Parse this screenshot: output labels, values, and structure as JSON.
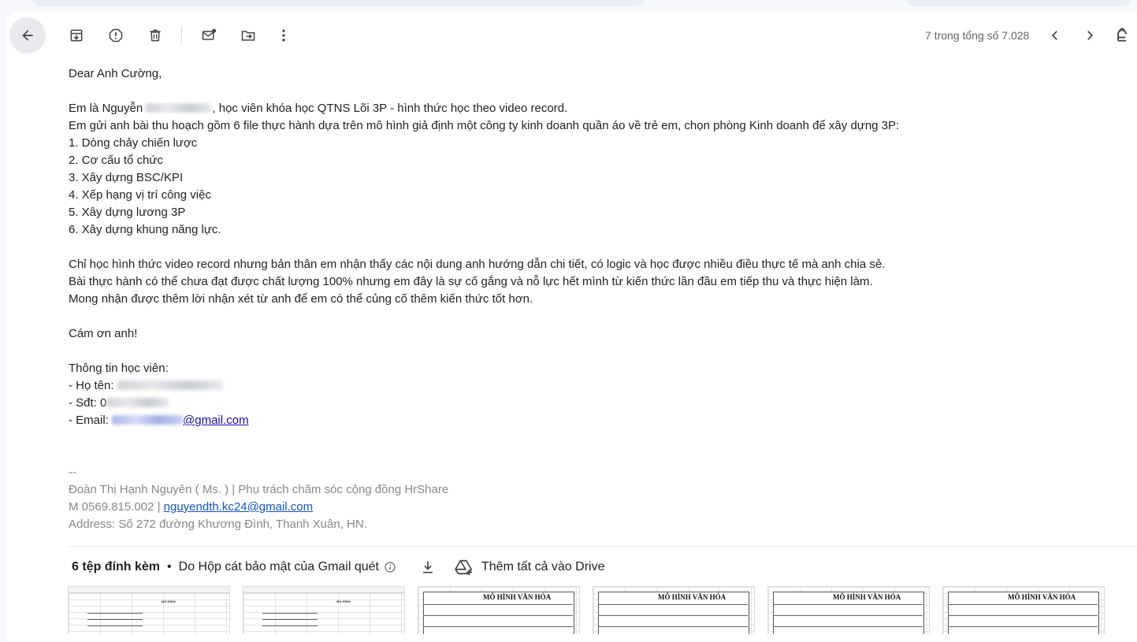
{
  "toolbar": {
    "pager_text": "7 trong tổng số 7.028",
    "icons": [
      "arrow-back-icon",
      "archive-icon",
      "report-spam-icon",
      "delete-icon",
      "mark-unread-icon",
      "move-to-icon",
      "more-vert-icon",
      "chevron-left-icon",
      "chevron-right-icon",
      "input-tools-icon"
    ]
  },
  "email": {
    "greeting": "Dear Anh Cường,",
    "intro_prefix": "Em là Nguyễn ",
    "intro_suffix": ", học viên khóa học QTNS Lõi 3P - hình thức học theo video record.",
    "line2": "Em gửi anh bài thu hoạch gồm 6 file thực hành dựa trên mô hình giả định một công ty kinh doanh quần áo về trẻ em, chọn phòng Kinh doanh để xây dựng 3P:",
    "list": [
      "1. Dòng chảy chiến lược",
      "2. Cơ cấu tổ chức",
      "3. Xây dựng BSC/KPI",
      "4. Xếp hạng vị trí công việc",
      "5. Xây dựng lương 3P",
      "6. Xây dựng khung năng lực."
    ],
    "para1": "Chỉ học hình thức video record nhưng bản thân em nhận thấy các nội dung anh hướng dẫn chi tiết, có logic và học được nhiều điều thực tế mà anh chia sẻ.",
    "para2": "Bài thực hành có thể chưa đạt được chất lượng 100% nhưng em đây là sự cố gắng và nỗ lực hết mình từ kiến thức lần đầu em tiếp thu và thực hiện làm.",
    "para3": "Mong nhận được thêm lời nhận xét từ anh để em có thể củng cố thêm kiến thức tốt hơn.",
    "thanks": "Cám ơn anh!",
    "info_title": "Thông tin học viên:",
    "info_name_label": "- Họ tên: ",
    "info_phone_label": "- Sđt: 0",
    "info_email_label": "- Email: ",
    "info_email_visible": "@gmail.com"
  },
  "signature": {
    "dashes": "--",
    "name_line": "Đoàn Thị Hạnh Nguyên ( Ms. ) | Phụ trách chăm sóc cộng đồng HrShare",
    "phone_prefix": "M 0569.815.002 | ",
    "email": "nguyendth.kc24@gmail.com",
    "address": "Address: Số 272 đường Khương Đình, Thanh Xuân, HN."
  },
  "attachments": {
    "count_label": "6 tệp đính kèm",
    "separator": "•",
    "scan_label": "Do Hộp cát bảo mật của Gmail quét",
    "add_all_drive": "Thêm tất cả vào Drive",
    "thumbs": [
      {
        "kind": "sheet",
        "title": "MÔ HÌNH:"
      },
      {
        "kind": "sheet",
        "title": "MÔ HÌNH:"
      },
      {
        "kind": "doc",
        "title": "MÔ HÌNH VĂN HÓA"
      },
      {
        "kind": "doc",
        "title": "MÔ HÌNH VĂN HÓA"
      },
      {
        "kind": "doc",
        "title": "MÔ HÌNH VĂN HÓA"
      },
      {
        "kind": "doc",
        "title": "MÔ HÌNH VĂN HÓA"
      }
    ]
  }
}
